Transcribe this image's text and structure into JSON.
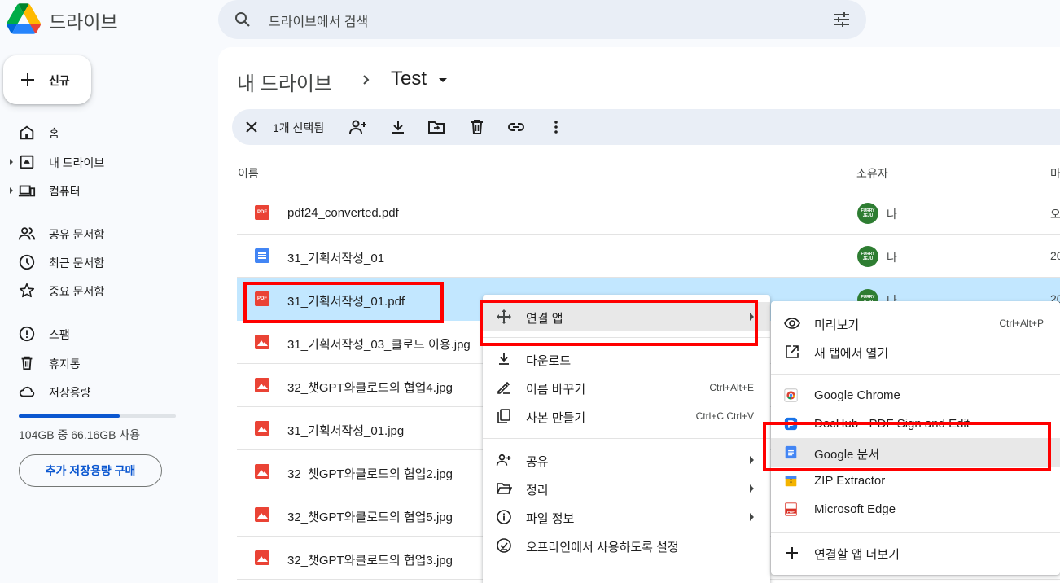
{
  "app": {
    "title": "드라이브"
  },
  "search": {
    "placeholder": "드라이브에서 검색"
  },
  "sidebar": {
    "new_label": "신규",
    "items": [
      {
        "label": "홈",
        "icon": "home-icon"
      },
      {
        "label": "내 드라이브",
        "icon": "my-drive-icon"
      },
      {
        "label": "컴퓨터",
        "icon": "computer-icon"
      },
      {
        "label": "공유 문서함",
        "icon": "shared-icon"
      },
      {
        "label": "최근 문서함",
        "icon": "clock-icon"
      },
      {
        "label": "중요 문서함",
        "icon": "star-icon"
      },
      {
        "label": "스팸",
        "icon": "spam-icon"
      },
      {
        "label": "휴지통",
        "icon": "trash-icon"
      },
      {
        "label": "저장용량",
        "icon": "cloud-icon"
      }
    ],
    "storage_text": "104GB 중 66.16GB 사용",
    "storage_used_fraction": 0.64,
    "buy_label": "추가 저장용량 구매"
  },
  "breadcrumb": {
    "root": "내 드라이브",
    "current": "Test"
  },
  "selection": {
    "count_label": "1개 선택됨"
  },
  "table": {
    "columns": {
      "name": "이름",
      "owner": "소유자",
      "modified": "마"
    },
    "rows": [
      {
        "name": "pdf24_converted.pdf",
        "type": "pdf",
        "owner": "나",
        "mod": "오"
      },
      {
        "name": "31_기획서작성_01",
        "type": "doc",
        "owner": "나",
        "mod": "20"
      },
      {
        "name": "31_기획서작성_01.pdf",
        "type": "pdf",
        "owner": "나",
        "mod": "20",
        "selected": true
      },
      {
        "name": "31_기획서작성_03_클로드 이용.jpg",
        "type": "image",
        "owner": "",
        "mod": ""
      },
      {
        "name": "32_챗GPT와클로드의 협업4.jpg",
        "type": "image",
        "owner": "",
        "mod": ""
      },
      {
        "name": "31_기획서작성_01.jpg",
        "type": "image",
        "owner": "",
        "mod": ""
      },
      {
        "name": "32_챗GPT와클로드의 협업2.jpg",
        "type": "image",
        "owner": "",
        "mod": ""
      },
      {
        "name": "32_챗GPT와클로드의 협업5.jpg",
        "type": "image",
        "owner": "",
        "mod": ""
      },
      {
        "name": "32_챗GPT와클로드의 협업3.jpg",
        "type": "image",
        "owner": "",
        "mod": ""
      }
    ],
    "avatar_text": "FURRY JEJU"
  },
  "context_menu": {
    "items": [
      {
        "label": "연결 앱",
        "shortcut": "",
        "submenu": true
      },
      {
        "label": "다운로드",
        "shortcut": ""
      },
      {
        "label": "이름 바꾸기",
        "shortcut": "Ctrl+Alt+E"
      },
      {
        "label": "사본 만들기",
        "shortcut": "Ctrl+C Ctrl+V"
      },
      {
        "label": "공유",
        "shortcut": "",
        "submenu": true
      },
      {
        "label": "정리",
        "shortcut": "",
        "submenu": true
      },
      {
        "label": "파일 정보",
        "shortcut": "",
        "submenu": true
      },
      {
        "label": "오프라인에서 사용하도록 설정",
        "shortcut": ""
      }
    ]
  },
  "open_with_menu": {
    "items": [
      {
        "label": "미리보기",
        "shortcut": "Ctrl+Alt+P"
      },
      {
        "label": "새 탭에서 열기",
        "shortcut": ""
      },
      {
        "label": "Google Chrome",
        "shortcut": ""
      },
      {
        "label": "DocHub - PDF Sign and Edit",
        "shortcut": ""
      },
      {
        "label": "Google 문서",
        "shortcut": ""
      },
      {
        "label": "ZIP Extractor",
        "shortcut": ""
      },
      {
        "label": "Microsoft Edge",
        "shortcut": ""
      },
      {
        "label": "연결할 앱 더보기",
        "shortcut": ""
      }
    ]
  },
  "colors": {
    "accent": "#0b57d0",
    "selected_row": "#c2e7ff",
    "highlight_box": "#ff0000"
  }
}
